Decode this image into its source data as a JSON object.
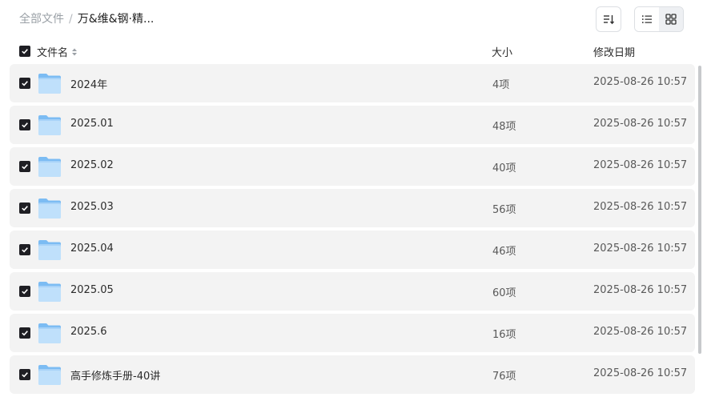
{
  "breadcrumb": {
    "root": "全部文件",
    "separator": "/",
    "current": "万&维&钢·精..."
  },
  "toolbar": {
    "sort_icon": "sort-icon",
    "list_view_icon": "list-view-icon",
    "grid_view_icon": "grid-view-icon"
  },
  "columns": {
    "name": "文件名",
    "size": "大小",
    "date": "修改日期"
  },
  "items": [
    {
      "name": "2024年",
      "size": "4项",
      "date": "2025-08-26 10:57"
    },
    {
      "name": "2025.01",
      "size": "48项",
      "date": "2025-08-26 10:57"
    },
    {
      "name": "2025.02",
      "size": "40项",
      "date": "2025-08-26 10:57"
    },
    {
      "name": "2025.03",
      "size": "56项",
      "date": "2025-08-26 10:57"
    },
    {
      "name": "2025.04",
      "size": "46项",
      "date": "2025-08-26 10:57"
    },
    {
      "name": "2025.05",
      "size": "60项",
      "date": "2025-08-26 10:57"
    },
    {
      "name": "2025.6",
      "size": "16项",
      "date": "2025-08-26 10:57"
    },
    {
      "name": "高手修炼手册-40讲",
      "size": "76项",
      "date": "2025-08-26 10:57"
    }
  ],
  "colors": {
    "row_bg": "#f3f3f3",
    "checkbox": "#1f1f24",
    "folder_light": "#bfe0fb",
    "folder_dark": "#7cbcf3"
  }
}
